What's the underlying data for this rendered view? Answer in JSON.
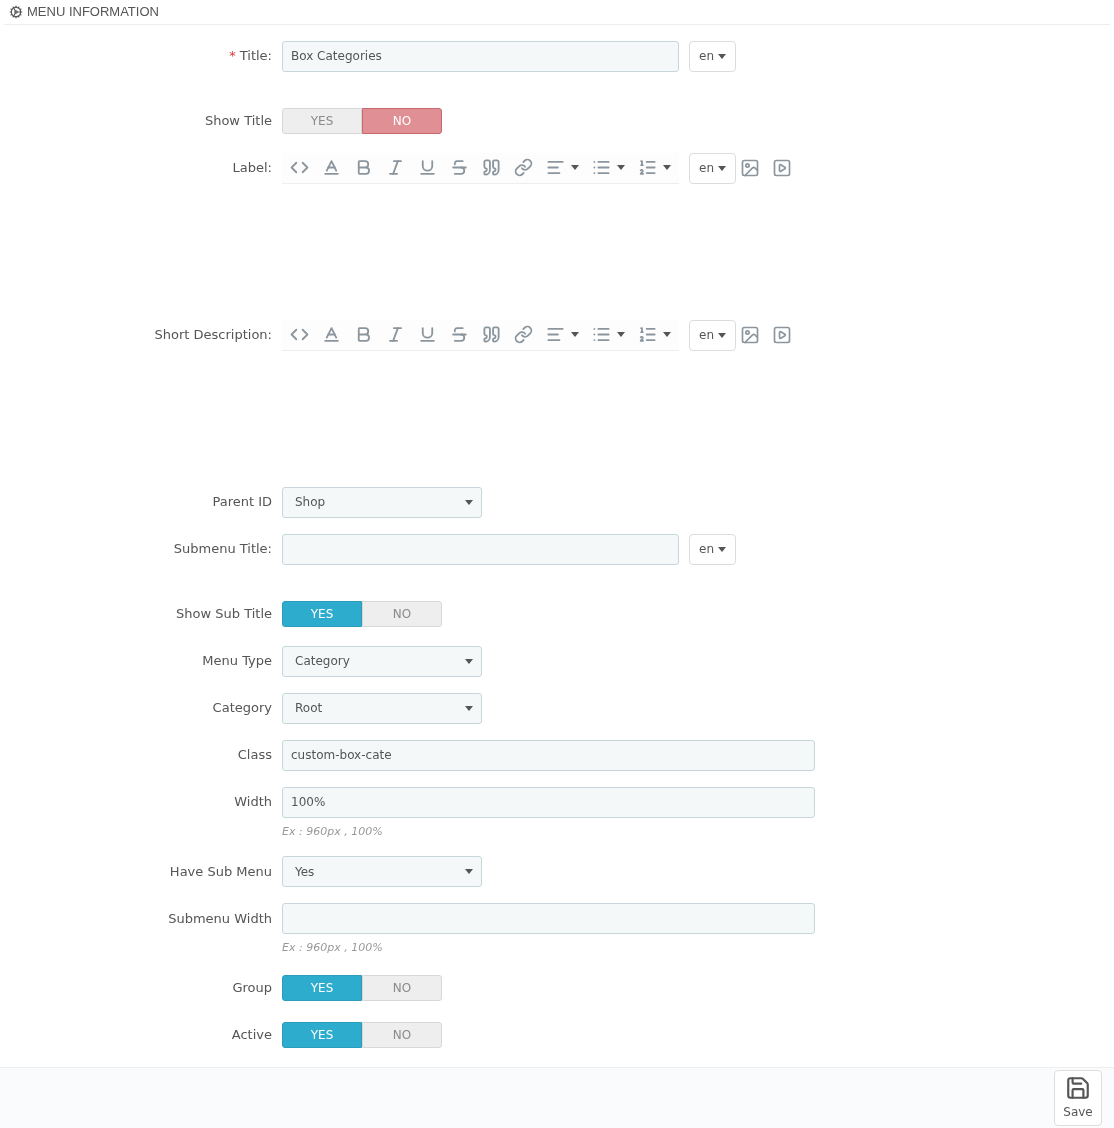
{
  "panel": {
    "title": "MENU INFORMATION"
  },
  "fields": [
    {
      "kind": "text",
      "label": "Title:",
      "required_mark": "*",
      "value": "Box Categories",
      "lang": "en"
    },
    {
      "kind": "toggle",
      "label": "Show Title",
      "options": [
        "YES",
        "NO"
      ],
      "on": false
    },
    {
      "kind": "editor",
      "label": "Label:",
      "lang": "en"
    },
    {
      "kind": "editor",
      "label": "Short Description:",
      "lang": "en"
    },
    {
      "kind": "select",
      "label": "Parent ID",
      "value": "Shop"
    },
    {
      "kind": "text",
      "label": "Submenu Title:",
      "lang": "en"
    },
    {
      "kind": "toggle",
      "label": "Show Sub Title",
      "options": [
        "YES",
        "NO"
      ],
      "on": true
    },
    {
      "kind": "select",
      "label": "Menu Type",
      "value": "Category"
    },
    {
      "kind": "select",
      "label": "Category",
      "value": "Root"
    },
    {
      "kind": "text",
      "label": "Class",
      "value": "custom-box-cate"
    },
    {
      "kind": "text",
      "label": "Width",
      "value": "100%",
      "hint": "Ex : 960px , 100%"
    },
    {
      "kind": "select",
      "label": "Have Sub Menu",
      "value": "Yes"
    },
    {
      "kind": "text",
      "label": "Submenu Width",
      "hint": "Ex : 960px , 100%"
    },
    {
      "kind": "toggle",
      "label": "Group",
      "options": [
        "YES",
        "NO"
      ],
      "on": true
    },
    {
      "kind": "toggle",
      "label": "Active",
      "options": [
        "YES",
        "NO"
      ],
      "on": true
    }
  ],
  "footer": {
    "save_label": "Save"
  }
}
